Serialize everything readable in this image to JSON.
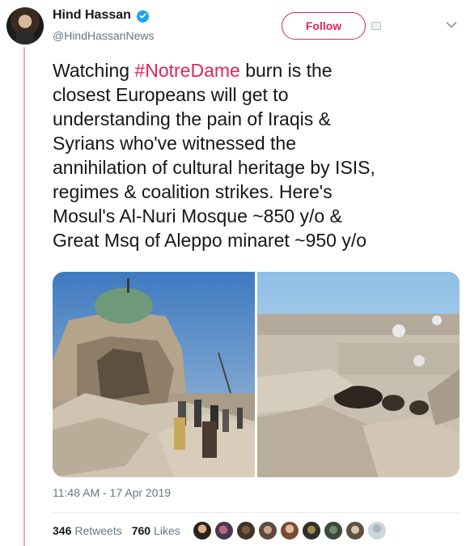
{
  "user": {
    "display_name": "Hind Hassan",
    "handle": "@HindHassanNews"
  },
  "follow_label": "Follow",
  "tweet": {
    "lines": [
      {
        "before": "Watching ",
        "hashtag": "#NotreDame",
        "after": " burn is the"
      },
      {
        "text": "closest Europeans will get to"
      },
      {
        "text": "understanding the pain of Iraqis &"
      },
      {
        "text": "Syrians who've witnessed the"
      },
      {
        "text": "annihilation of cultural heritage by ISIS,"
      },
      {
        "text": "regimes & coalition strikes. Here's"
      },
      {
        "text": "Mosul's Al-Nuri Mosque ~850 y/o &"
      },
      {
        "text": "Great Msq of Aleppo minaret ~950 y/o"
      }
    ],
    "timestamp": "11:48 AM - 17 Apr 2019"
  },
  "stats": {
    "retweets_count": "346",
    "retweets_label": "Retweets",
    "likes_count": "760",
    "likes_label": "Likes"
  },
  "colors": {
    "accent": "#e0245e",
    "verified": "#1da1f2",
    "thread_line": "#f4a6ad",
    "secondary_text": "#657786"
  },
  "icons": [
    "verified-badge-icon",
    "chevron-down-icon"
  ]
}
